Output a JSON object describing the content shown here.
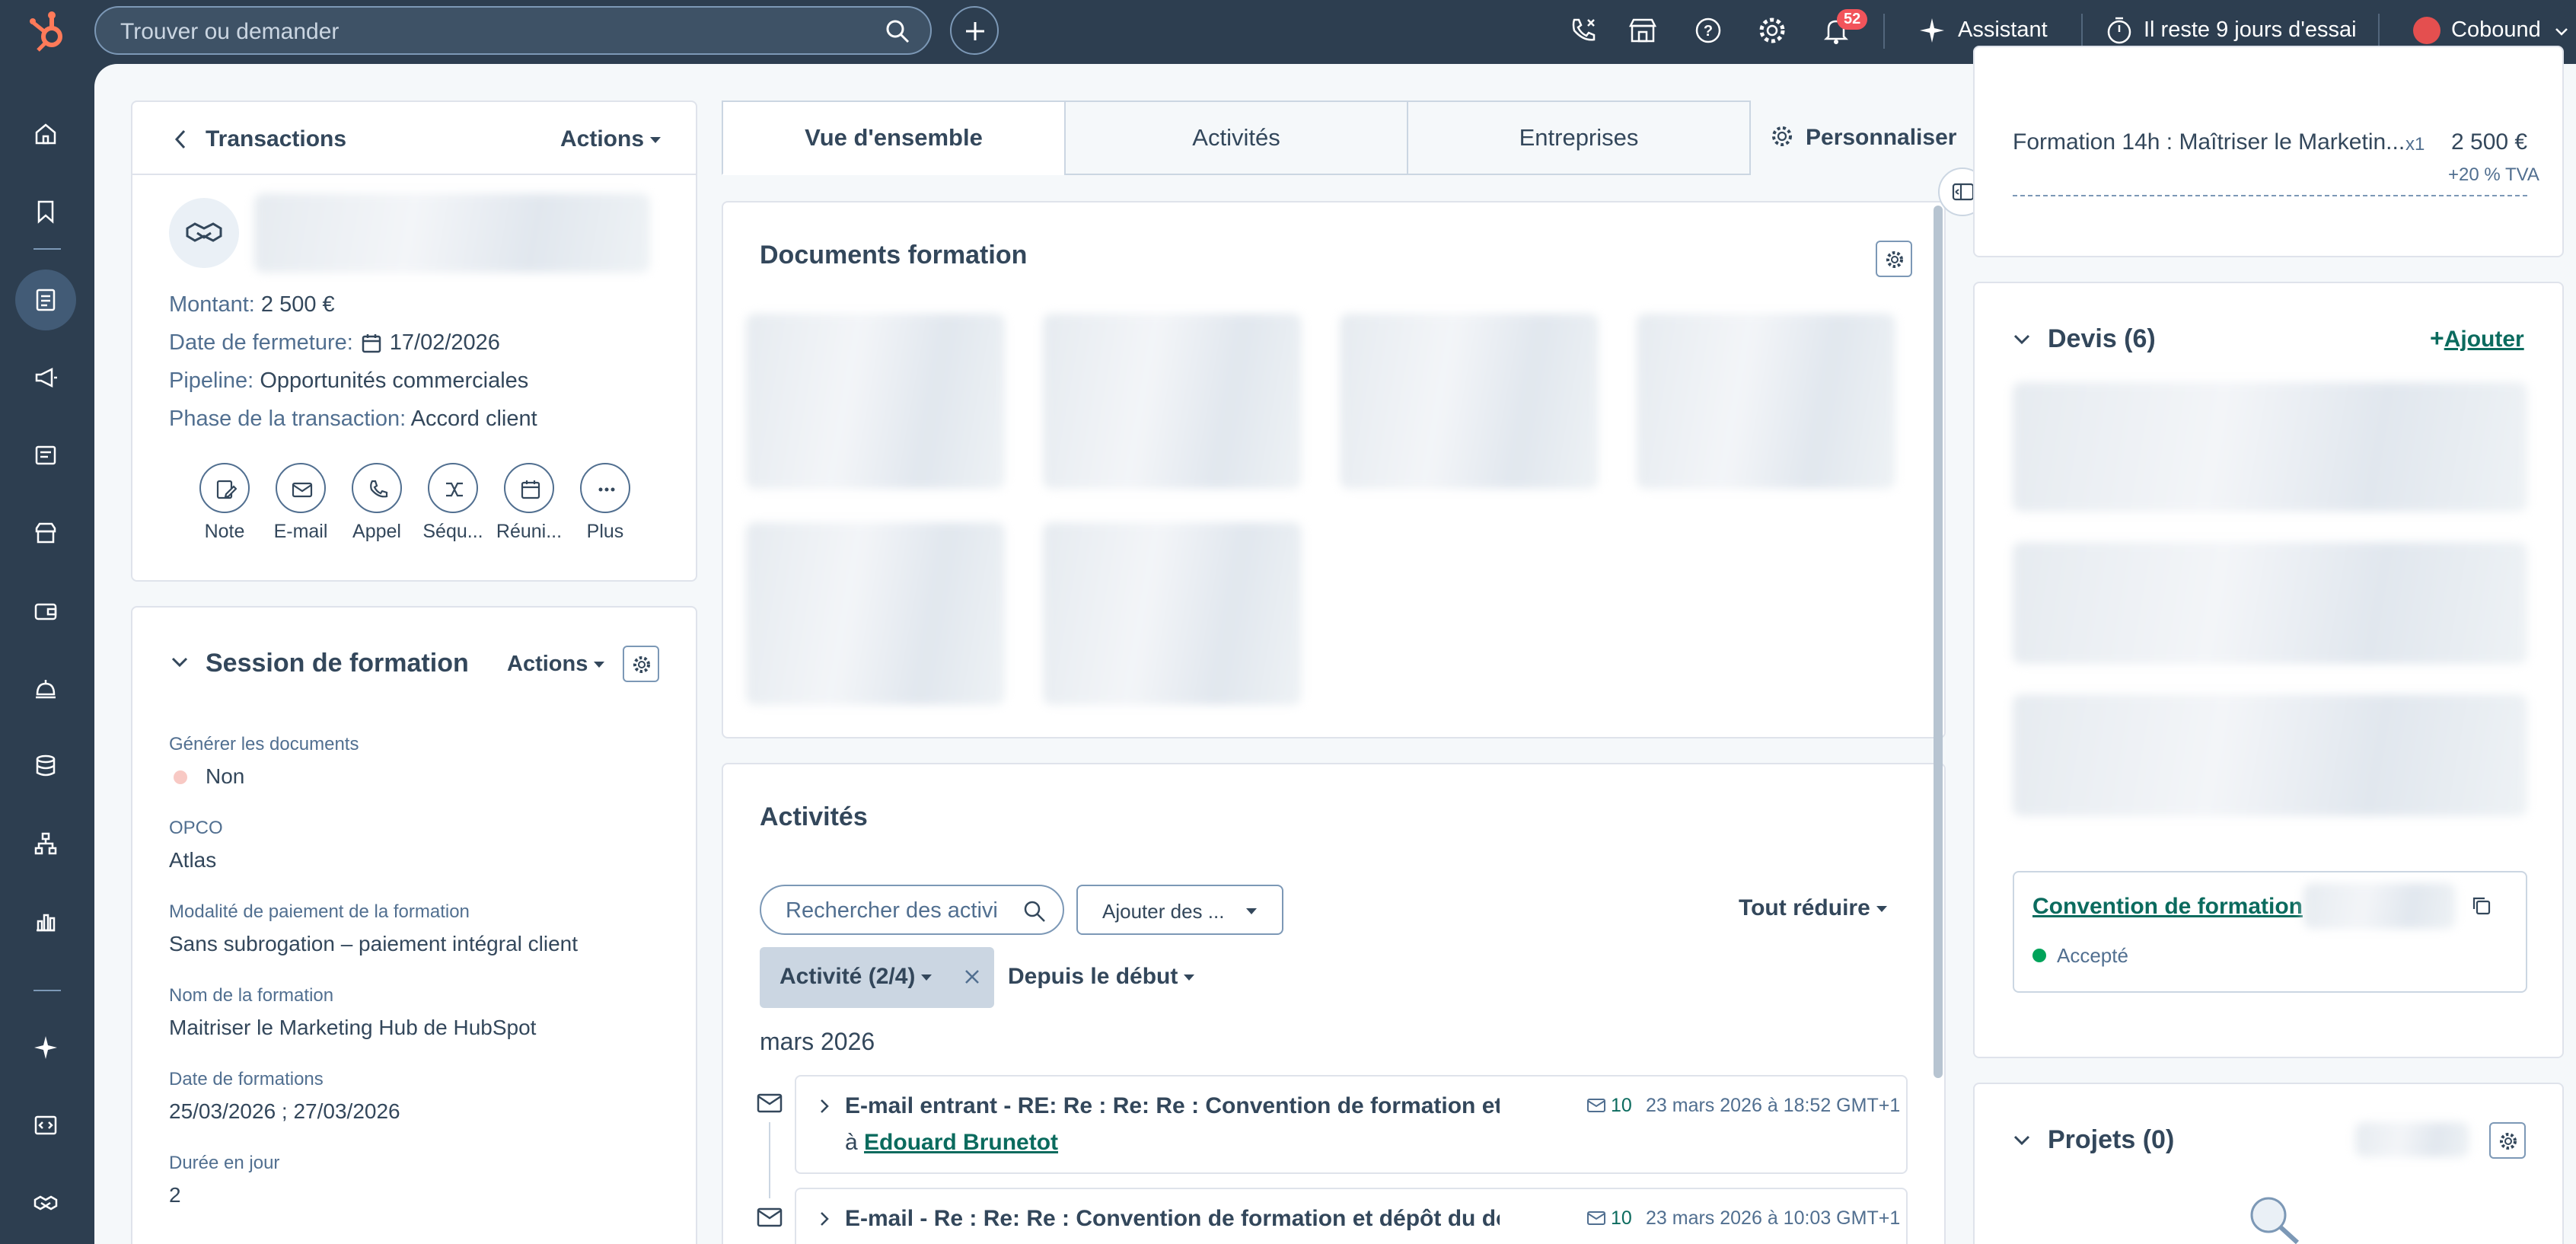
{
  "nav": {
    "search_placeholder": "Trouver ou demander",
    "notif_count": "52",
    "assistant_label": "Assistant",
    "trial_label": "Il reste 9 jours d'essai",
    "account_label": "Cobound"
  },
  "record": {
    "back_label": "Transactions",
    "actions_label": "Actions",
    "fields": [
      {
        "label": "Montant:",
        "value": "2 500 €"
      },
      {
        "label": "Date de fermeture:",
        "value": "17/02/2026"
      },
      {
        "label": "Pipeline:",
        "value": "Opportunités commerciales"
      },
      {
        "label": "Phase de la transaction:",
        "value": "Accord client"
      }
    ],
    "quick_actions": [
      "Note",
      "E-mail",
      "Appel",
      "Séqu...",
      "Réuni...",
      "Plus"
    ]
  },
  "session": {
    "title": "Session de formation",
    "actions_label": "Actions",
    "properties": [
      {
        "label": "Générer les documents",
        "value": "Non"
      },
      {
        "label": "OPCO",
        "value": "Atlas"
      },
      {
        "label": "Modalité de paiement de la formation",
        "value": "Sans subrogation – paiement intégral client"
      },
      {
        "label": "Nom de la formation",
        "value": "Maitriser le Marketing Hub de HubSpot"
      },
      {
        "label": "Date de formations",
        "value": "25/03/2026 ; 27/03/2026"
      },
      {
        "label": "Durée en jour",
        "value": "2"
      }
    ]
  },
  "tabs": [
    "Vue d'ensemble",
    "Activités",
    "Entreprises"
  ],
  "customize_label": "Personnaliser",
  "documents": {
    "title": "Documents formation"
  },
  "activities": {
    "title": "Activités",
    "search_placeholder": "Rechercher des activi",
    "add_dropdown": "Ajouter des ...",
    "collapse_label": "Tout réduire",
    "filter_label": "Activité (2/4)",
    "since_label": "Depuis le début",
    "month": "mars 2026",
    "items": [
      {
        "title": "E-mail entrant - RE: Re : Re: Re : Convention de formation et dép...",
        "to_prefix": "à",
        "to": "Edouard Brunetot",
        "count": "10",
        "date": "23 mars 2026 à 18:52 GMT+1"
      },
      {
        "title": "E-mail - Re : Re: Re : Convention de formation et dépôt du dossie...",
        "count": "10",
        "date": "23 mars 2026 à 10:03 GMT+1"
      }
    ]
  },
  "right": {
    "line_item": {
      "name": "Formation 14h : Maîtriser le Marketin...",
      "qty": "x1",
      "price": "2 500 €",
      "tax": "+20 % TVA"
    },
    "quotes": {
      "title": "Devis (6)",
      "add_label": "Ajouter",
      "convention_label": "Convention de formation",
      "status": "Accepté"
    },
    "projects": {
      "title": "Projets (0)"
    }
  },
  "colors": {
    "accent": "#0b6b5e",
    "navbg": "#2d3e50",
    "badge": "#f2545b",
    "accepted": "#00a35a"
  }
}
